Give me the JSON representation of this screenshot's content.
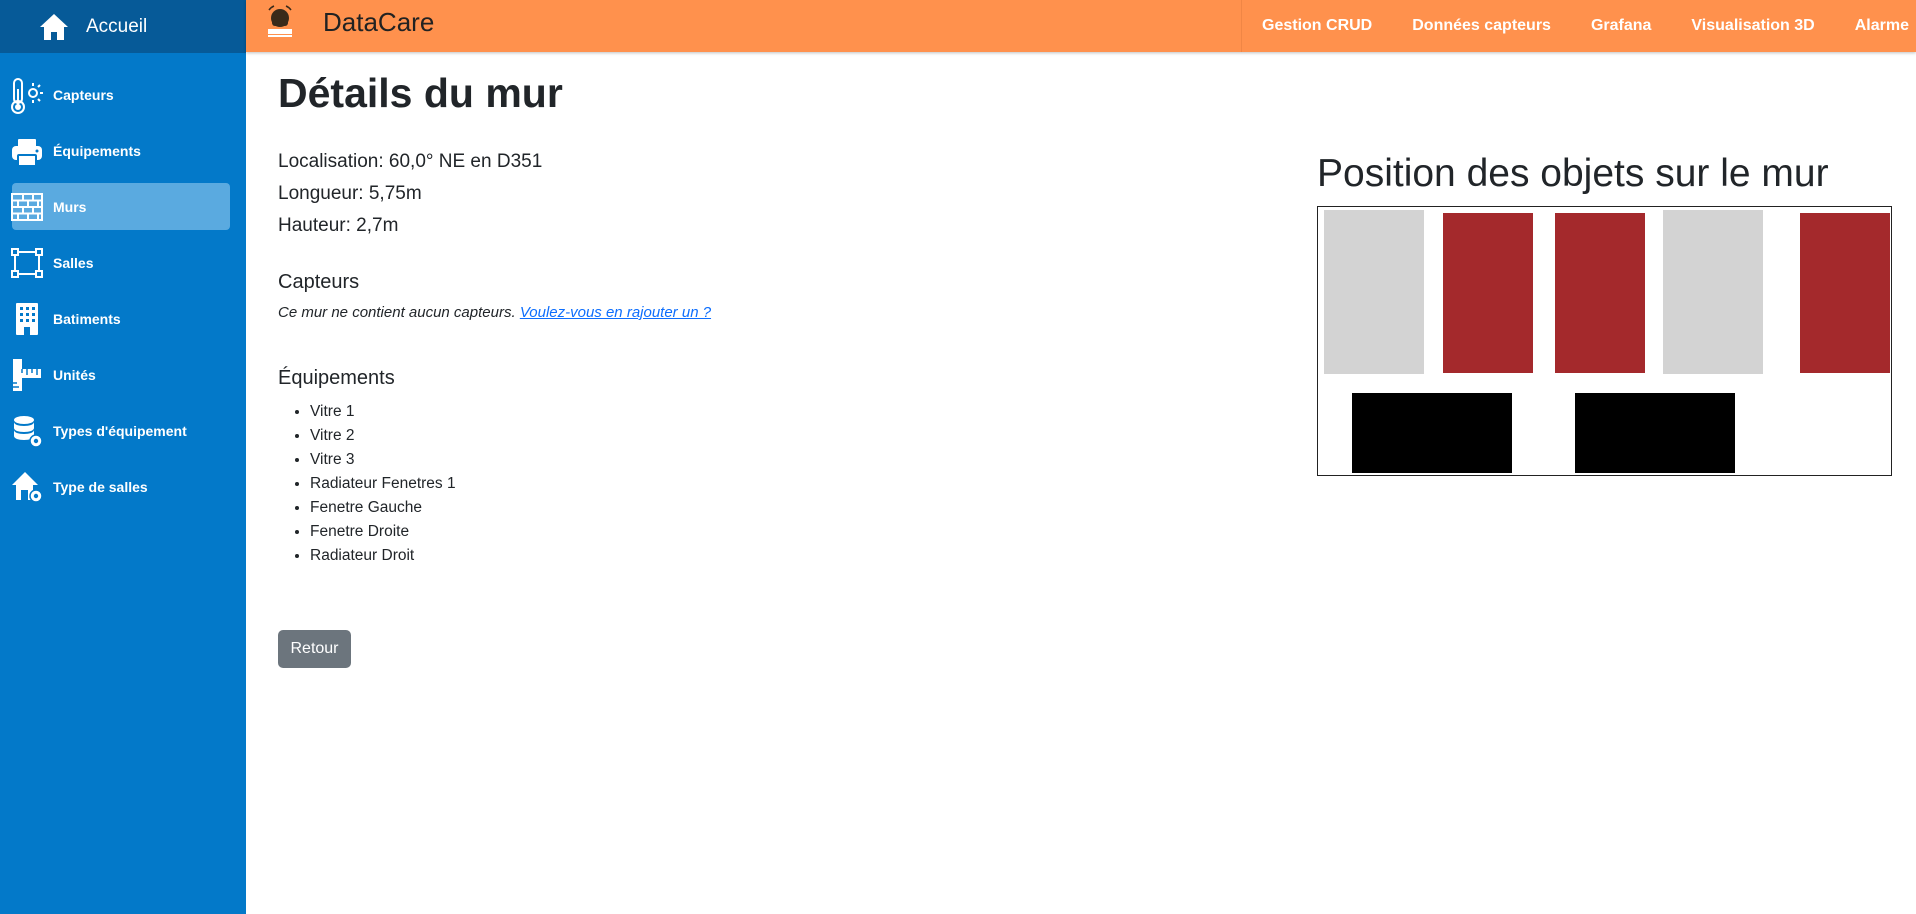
{
  "sidebar": {
    "home_label": "Accueil",
    "items": [
      {
        "label": "Capteurs",
        "icon": "thermometer-icon"
      },
      {
        "label": "Équipements",
        "icon": "printer-icon"
      },
      {
        "label": "Murs",
        "icon": "brick-wall-icon"
      },
      {
        "label": "Salles",
        "icon": "room-layout-icon"
      },
      {
        "label": "Batiments",
        "icon": "building-icon"
      },
      {
        "label": "Unités",
        "icon": "ruler-icon"
      },
      {
        "label": "Types d'équipement",
        "icon": "database-gear-icon"
      },
      {
        "label": "Type de salles",
        "icon": "house-gear-icon"
      }
    ],
    "active_item": "Murs",
    "colors": {
      "background": "#0379c9",
      "home_background": "#065a98",
      "active_background": "#5aaae0"
    }
  },
  "topbar": {
    "brand_name": "DataCare",
    "nav": [
      "Gestion CRUD",
      "Données capteurs",
      "Grafana",
      "Visualisation 3D",
      "Alarme"
    ],
    "color": "#ff914d"
  },
  "main": {
    "title": "Détails du mur",
    "localisation": "Localisation: 60,0° NE en D351",
    "longueur": "Longueur: 5,75m",
    "hauteur": "Hauteur: 2,7m",
    "capteurs_title": "Capteurs",
    "capteurs_note": "Ce mur ne contient aucun capteurs.",
    "capteurs_link": "Voulez-vous en rajouter un ?",
    "equipements_title": "Équipements",
    "equipements": [
      "Vitre 1",
      "Vitre 2",
      "Vitre 3",
      "Radiateur Fenetres 1",
      "Fenetre Gauche",
      "Fenetre Droite",
      "Radiateur Droit"
    ],
    "retour_label": "Retour"
  },
  "wall": {
    "title": "Position des objets sur le mur",
    "object_colors": {
      "light_gray": "#d3d3d3",
      "red": "#a4292c",
      "black": "#000000"
    }
  }
}
